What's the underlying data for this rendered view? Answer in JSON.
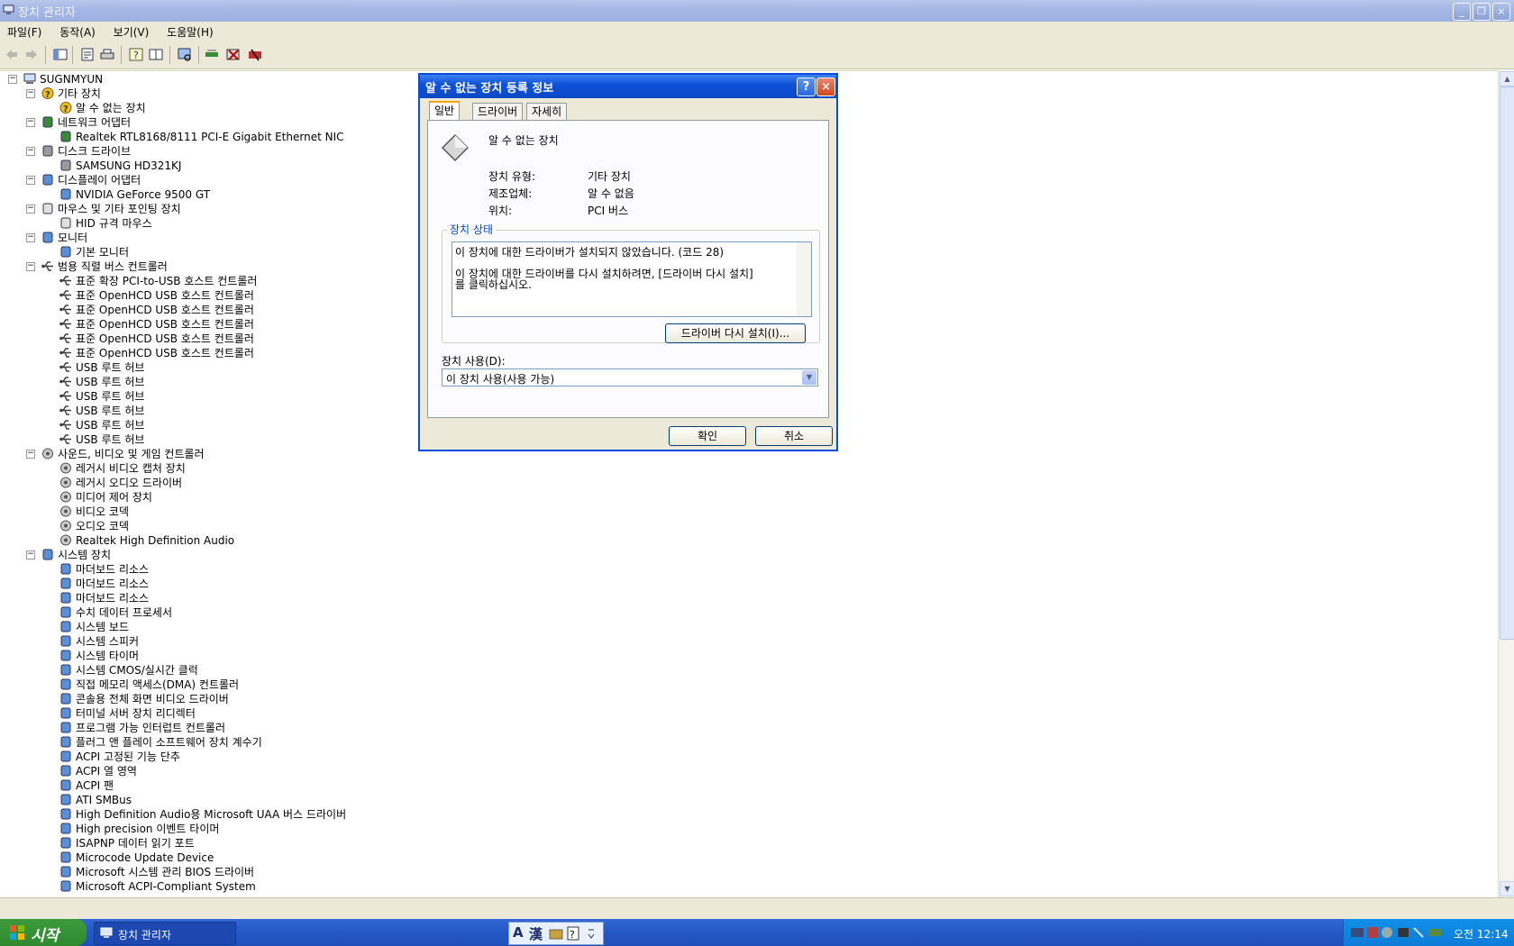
{
  "window": {
    "title": "장치 관리자",
    "min": "_",
    "max": "❐",
    "close": "×"
  },
  "menu": [
    "파일(F)",
    "동작(A)",
    "보기(V)",
    "도움말(H)"
  ],
  "tree": [
    {
      "level": 0,
      "label": "SUGNMYUN",
      "icon": "computer-icon",
      "expander": "−"
    },
    {
      "level": 1,
      "label": "기타 장치",
      "icon": "question-icon",
      "expander": "−"
    },
    {
      "level": 2,
      "label": "알 수 없는 장치",
      "icon": "unknown-device-icon"
    },
    {
      "level": 1,
      "label": "네트워크 어댑터",
      "icon": "network-adapter-icon",
      "expander": "−"
    },
    {
      "level": 2,
      "label": "Realtek RTL8168/8111 PCI-E Gigabit Ethernet NIC",
      "icon": "network-adapter-icon"
    },
    {
      "level": 1,
      "label": "디스크 드라이브",
      "icon": "disk-drive-icon",
      "expander": "−"
    },
    {
      "level": 2,
      "label": "SAMSUNG HD321KJ",
      "icon": "disk-drive-icon"
    },
    {
      "level": 1,
      "label": "디스플레이 어댑터",
      "icon": "display-adapter-icon",
      "expander": "−"
    },
    {
      "level": 2,
      "label": "NVIDIA GeForce 9500 GT",
      "icon": "display-adapter-icon"
    },
    {
      "level": 1,
      "label": "마우스 및 기타 포인팅 장치",
      "icon": "mouse-icon",
      "expander": "−"
    },
    {
      "level": 2,
      "label": "HID 규격 마우스",
      "icon": "mouse-icon"
    },
    {
      "level": 1,
      "label": "모니터",
      "icon": "monitor-icon",
      "expander": "−"
    },
    {
      "level": 2,
      "label": "기본 모니터",
      "icon": "monitor-icon"
    },
    {
      "level": 1,
      "label": "범용 직렬 버스 컨트롤러",
      "icon": "usb-icon",
      "expander": "−"
    },
    {
      "level": 2,
      "label": "표준 확장 PCI-to-USB 호스트 컨트롤러",
      "icon": "usb-icon"
    },
    {
      "level": 2,
      "label": "표준 OpenHCD USB 호스트 컨트롤러",
      "icon": "usb-icon"
    },
    {
      "level": 2,
      "label": "표준 OpenHCD USB 호스트 컨트롤러",
      "icon": "usb-icon"
    },
    {
      "level": 2,
      "label": "표준 OpenHCD USB 호스트 컨트롤러",
      "icon": "usb-icon"
    },
    {
      "level": 2,
      "label": "표준 OpenHCD USB 호스트 컨트롤러",
      "icon": "usb-icon"
    },
    {
      "level": 2,
      "label": "표준 OpenHCD USB 호스트 컨트롤러",
      "icon": "usb-icon"
    },
    {
      "level": 2,
      "label": "USB 루트 허브",
      "icon": "usb-icon"
    },
    {
      "level": 2,
      "label": "USB 루트 허브",
      "icon": "usb-icon"
    },
    {
      "level": 2,
      "label": "USB 루트 허브",
      "icon": "usb-icon"
    },
    {
      "level": 2,
      "label": "USB 루트 허브",
      "icon": "usb-icon"
    },
    {
      "level": 2,
      "label": "USB 루트 허브",
      "icon": "usb-icon"
    },
    {
      "level": 2,
      "label": "USB 루트 허브",
      "icon": "usb-icon"
    },
    {
      "level": 1,
      "label": "사운드, 비디오 및 게임 컨트롤러",
      "icon": "sound-icon",
      "expander": "−"
    },
    {
      "level": 2,
      "label": "레거시 비디오 캡처 장치",
      "icon": "sound-icon"
    },
    {
      "level": 2,
      "label": "레거시 오디오 드라이버",
      "icon": "sound-icon"
    },
    {
      "level": 2,
      "label": "미디어 제어 장치",
      "icon": "sound-icon"
    },
    {
      "level": 2,
      "label": "비디오 코덱",
      "icon": "sound-icon"
    },
    {
      "level": 2,
      "label": "오디오 코덱",
      "icon": "sound-icon"
    },
    {
      "level": 2,
      "label": "Realtek High Definition Audio",
      "icon": "sound-icon"
    },
    {
      "level": 1,
      "label": "시스템 장치",
      "icon": "system-device-icon",
      "expander": "−"
    },
    {
      "level": 2,
      "label": "마더보드 리소스",
      "icon": "system-device-icon"
    },
    {
      "level": 2,
      "label": "마더보드 리소스",
      "icon": "system-device-icon"
    },
    {
      "level": 2,
      "label": "마더보드 리소스",
      "icon": "system-device-icon"
    },
    {
      "level": 2,
      "label": "수치 데이터 프로세서",
      "icon": "system-device-icon"
    },
    {
      "level": 2,
      "label": "시스템 보드",
      "icon": "system-device-icon"
    },
    {
      "level": 2,
      "label": "시스템 스피커",
      "icon": "system-device-icon"
    },
    {
      "level": 2,
      "label": "시스템 타이머",
      "icon": "system-device-icon"
    },
    {
      "level": 2,
      "label": "시스템 CMOS/실시간 클럭",
      "icon": "system-device-icon"
    },
    {
      "level": 2,
      "label": "직접 메모리 액세스(DMA) 컨트롤러",
      "icon": "system-device-icon"
    },
    {
      "level": 2,
      "label": "콘솔용 전체 화면 비디오 드라이버",
      "icon": "system-device-icon"
    },
    {
      "level": 2,
      "label": "터미널 서버 장치 리디렉터",
      "icon": "system-device-icon"
    },
    {
      "level": 2,
      "label": "프로그램 가능 인터럽트 컨트롤러",
      "icon": "system-device-icon"
    },
    {
      "level": 2,
      "label": "플러그 앤 플레이 소프트웨어 장치 계수기",
      "icon": "system-device-icon"
    },
    {
      "level": 2,
      "label": "ACPI 고정된 기능 단추",
      "icon": "system-device-icon"
    },
    {
      "level": 2,
      "label": "ACPI 열 영역",
      "icon": "system-device-icon"
    },
    {
      "level": 2,
      "label": "ACPI 팬",
      "icon": "system-device-icon"
    },
    {
      "level": 2,
      "label": "ATI SMBus",
      "icon": "system-device-icon"
    },
    {
      "level": 2,
      "label": "High Definition Audio용 Microsoft UAA 버스 드라이버",
      "icon": "system-device-icon"
    },
    {
      "level": 2,
      "label": "High precision 이벤트 타이머",
      "icon": "system-device-icon"
    },
    {
      "level": 2,
      "label": "ISAPNP 데이터 읽기 포트",
      "icon": "system-device-icon"
    },
    {
      "level": 2,
      "label": "Microcode Update Device",
      "icon": "system-device-icon"
    },
    {
      "level": 2,
      "label": "Microsoft 시스템 관리 BIOS 드라이버",
      "icon": "system-device-icon"
    },
    {
      "level": 2,
      "label": "Microsoft ACPI-Compliant System",
      "icon": "system-device-icon"
    }
  ],
  "dialog": {
    "title": "알 수 없는 장치 등록 정보",
    "help": "?",
    "close": "×",
    "tabs": [
      "일반",
      "드라이버",
      "자세히"
    ],
    "device_name": "알 수 없는 장치",
    "props": [
      {
        "label": "장치 유형:",
        "value": "기타 장치"
      },
      {
        "label": "제조업체:",
        "value": "알 수 없음"
      },
      {
        "label": "위치:",
        "value": "PCI 버스"
      }
    ],
    "status_group": "장치 상태",
    "status_line1": "이 장치에 대한 드라이버가 설치되지 않았습니다. (코드 28)",
    "status_line2": "이 장치에 대한 드라이버를 다시 설치하려면, [드라이버 다시 설치]",
    "status_line3": "를 클릭하십시오.",
    "reinstall_button": "드라이버 다시 설치(I)...",
    "usage_label": "장치 사용(D):",
    "usage_value": "이 장치 사용(사용 가능)",
    "ok": "확인",
    "cancel": "취소"
  },
  "taskbar": {
    "start": "시작",
    "task": "장치 관리자",
    "clock": "오전 12:14",
    "lang1": "A",
    "lang2": "漢"
  },
  "colors": {
    "dialog_title": "#0b48c6",
    "taskbar": "#2457c6",
    "start": "#2f8a2f",
    "group_legend": "#0046d5"
  }
}
